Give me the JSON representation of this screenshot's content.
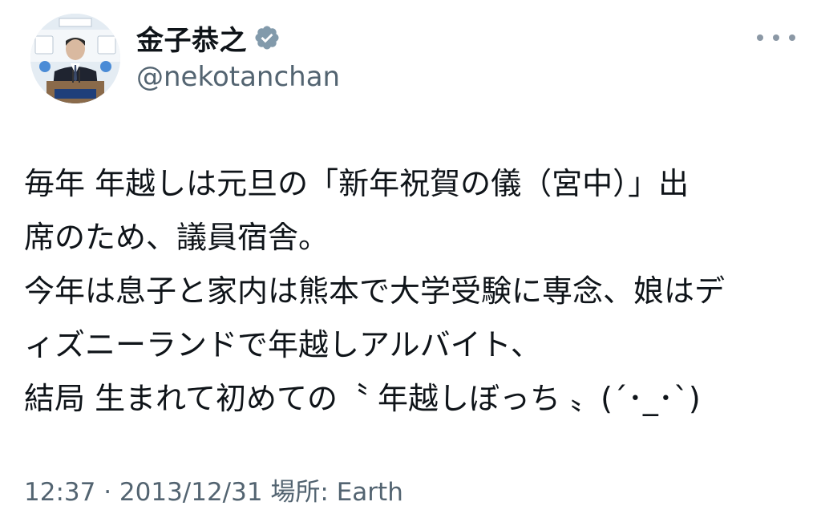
{
  "author": {
    "display_name": "金子恭之",
    "handle": "@nekotanchan",
    "verified_icon": "verified-badge-icon",
    "avatar_icon": "profile-photo-avatar"
  },
  "menu": {
    "icon": "more-options-icon"
  },
  "tweet": {
    "lines": [
      "毎年 年越しは元旦の「新年祝賀の儀（宮中）」出",
      "席のため、議員宿舎。",
      "今年は息子と家内は熊本で大学受験に専念、娘はデ",
      "ィズニーランドで年越しアルバイト、",
      "結局 生まれて初めての〝 年越しぼっち 〟(´･_･`)"
    ]
  },
  "meta": {
    "text": "12:37 · 2013/12/31 場所: Earth"
  },
  "colors": {
    "text_primary": "#0f1419",
    "text_secondary": "#536471",
    "verified_fill": "#829aab"
  }
}
